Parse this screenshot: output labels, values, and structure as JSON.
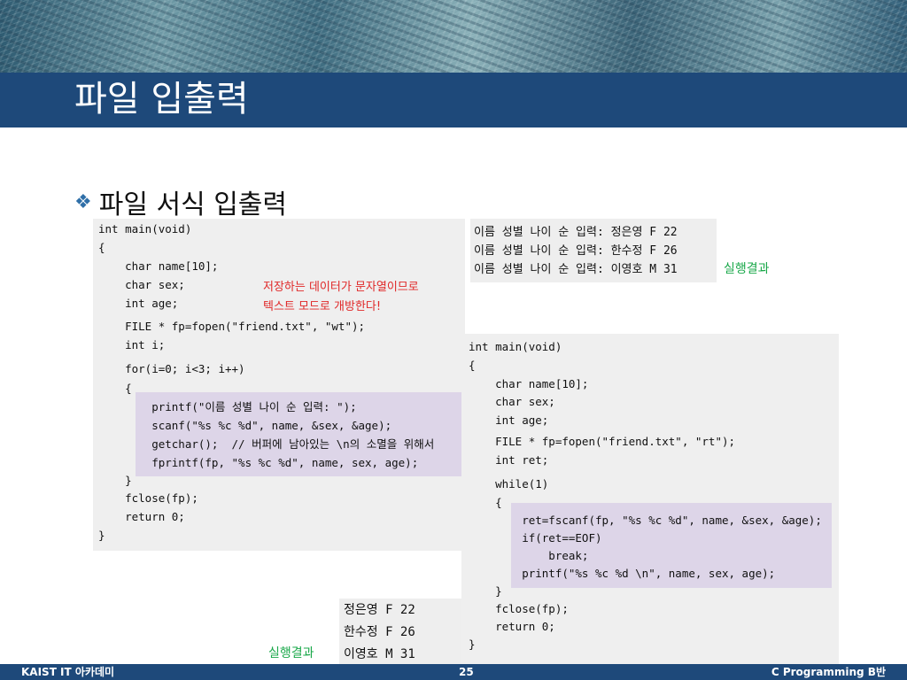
{
  "slide": {
    "title": "파일 입출력",
    "bullet": "파일 서식 입출력"
  },
  "left_code": {
    "lines": [
      "int main(void)",
      "{",
      "    char name[10];",
      "    char sex;",
      "    int age;",
      "    FILE * fp=fopen(\"friend.txt\", \"wt\");",
      "    int i;",
      "    for(i=0; i<3; i++)",
      "    {",
      "        printf(\"이름 성별 나이 순 입력: \");",
      "        scanf(\"%s %c %d\", name, &sex, &age);",
      "        getchar();  // 버퍼에 남아있는 \\n의 소멸을 위해서",
      "        fprintf(fp, \"%s %c %d\", name, sex, age);",
      "    }",
      "    fclose(fp);",
      "    return 0;",
      "}"
    ],
    "note_line1": "저장하는 데이터가 문자열이므로",
    "note_line2": "텍스트 모드로 개방한다!"
  },
  "right_code": {
    "lines": [
      "int main(void)",
      "{",
      "    char name[10];",
      "    char sex;",
      "    int age;",
      "    FILE * fp=fopen(\"friend.txt\", \"rt\");",
      "    int ret;",
      "    while(1)",
      "    {",
      "        ret=fscanf(fp, \"%s %c %d\", name, &sex, &age);",
      "        if(ret==EOF)",
      "            break;",
      "        printf(\"%s %c %d \\n\", name, sex, age);",
      "    }",
      "    fclose(fp);",
      "    return 0;",
      "}"
    ]
  },
  "result_top": {
    "lines": [
      "이름 성별 나이 순 입력: 정은영 F 22",
      "이름 성별 나이 순 입력: 한수정 F 26",
      "이름 성별 나이 순 입력: 이영호 M 31"
    ],
    "label": "실행결과"
  },
  "result_bottom": {
    "lines": [
      "정은영 F 22",
      "한수정 F 26",
      "이영호 M 31"
    ],
    "label": "실행결과"
  },
  "footer": {
    "left": "KAIST IT 아카데미",
    "page": "25",
    "right": "C Programming B반"
  }
}
